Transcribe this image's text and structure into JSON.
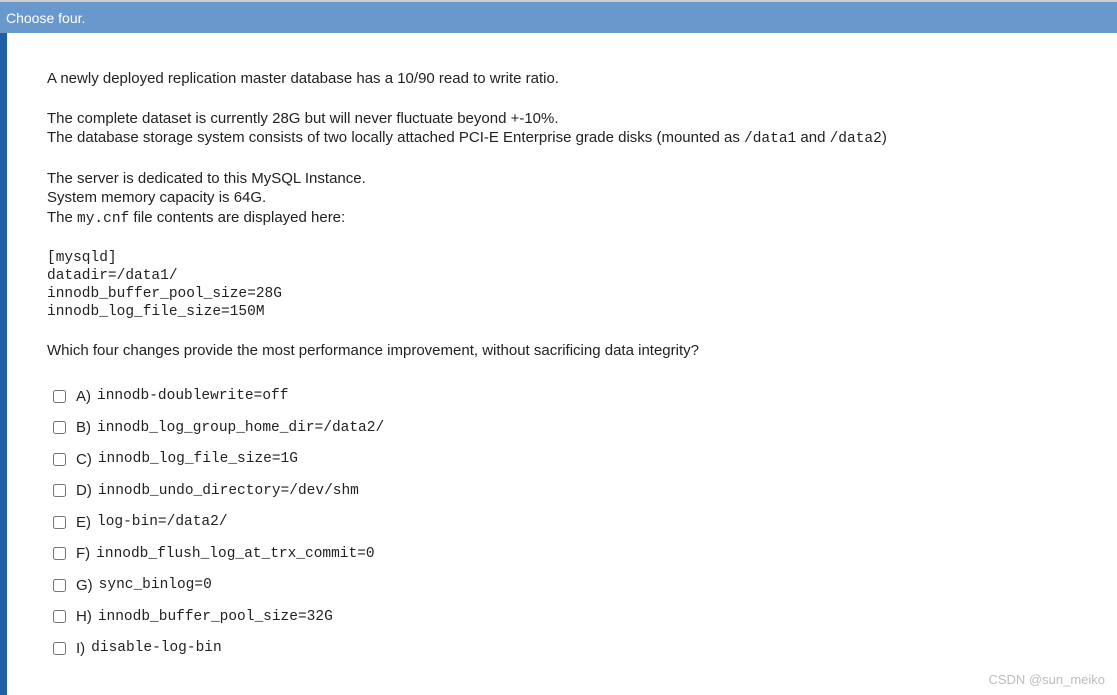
{
  "header": {
    "instruction": "Choose four."
  },
  "body": {
    "p1": "A newly deployed replication master database has a 10/90 read to write ratio.",
    "p2a": "The complete dataset is currently 28G but will never fluctuate beyond +-10%.",
    "p2b_pre": "The database storage system consists of two locally attached PCI-E Enterprise grade disks (mounted as ",
    "p2b_code1": "/data1",
    "p2b_mid": " and ",
    "p2b_code2": "/data2",
    "p2b_post": ")",
    "p3a": "The server is dedicated to this MySQL Instance.",
    "p3b": "System memory capacity is 64G.",
    "p3c_pre": "The ",
    "p3c_code": "my.cnf",
    "p3c_post": " file contents are displayed here:",
    "config": {
      "l1": "[mysqld]",
      "l2": "datadir=/data1/",
      "l3": "innodb_buffer_pool_size=28G",
      "l4": "innodb_log_file_size=150M"
    },
    "question": "Which four changes provide the most performance improvement, without sacrificing data integrity?"
  },
  "choices": [
    {
      "letter": "A)",
      "text": "innodb-doublewrite=off"
    },
    {
      "letter": "B)",
      "text": "innodb_log_group_home_dir=/data2/"
    },
    {
      "letter": "C)",
      "text": "innodb_log_file_size=1G"
    },
    {
      "letter": "D)",
      "text": "innodb_undo_directory=/dev/shm"
    },
    {
      "letter": "E)",
      "text": "log-bin=/data2/"
    },
    {
      "letter": "F)",
      "text": "innodb_flush_log_at_trx_commit=0"
    },
    {
      "letter": "G)",
      "text": "sync_binlog=0"
    },
    {
      "letter": "H)",
      "text": "innodb_buffer_pool_size=32G"
    },
    {
      "letter": "I)",
      "text": "disable-log-bin"
    }
  ],
  "watermark": "CSDN @sun_meiko"
}
